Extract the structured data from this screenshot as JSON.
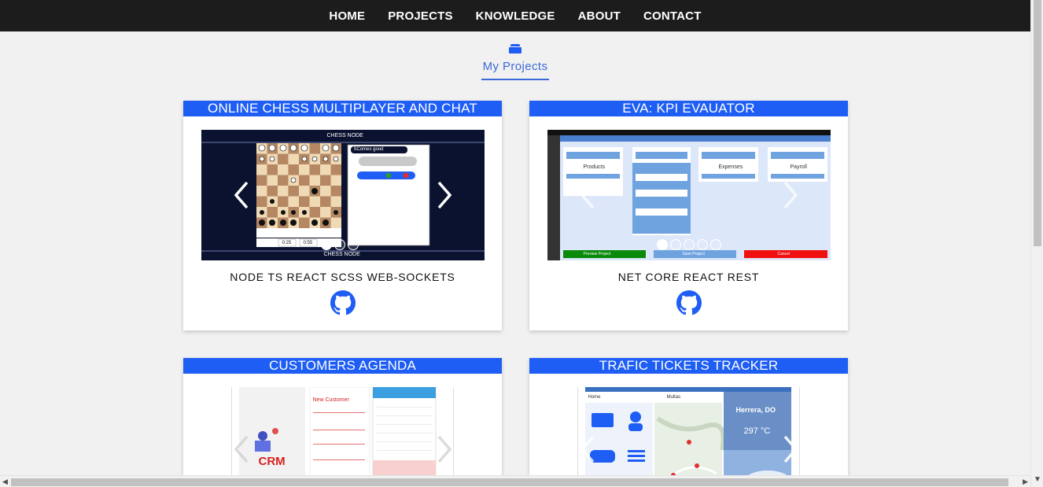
{
  "nav": {
    "items": [
      "HOME",
      "PROJECTS",
      "KNOWLEDGE",
      "ABOUT",
      "CONTACT"
    ]
  },
  "section": {
    "icon": "briefcase-icon",
    "title": "My Projects"
  },
  "projects": [
    {
      "title": "ONLINE CHESS MULTIPLAYER AND CHAT",
      "tech": "NODE TS REACT SCSS WEB-SOCKETS",
      "link_icon": "github-icon",
      "dots": 3,
      "active_dot": 1,
      "screenshot": {
        "header": "CHESS NODE",
        "footer": "CHESS NODE",
        "chat_message": "SComes good",
        "timer_left": "0:25",
        "timer_right": "0:55"
      }
    },
    {
      "title": "EVA: KPI EVAUATOR",
      "tech": "NET CORE REACT REST",
      "link_icon": "github-icon",
      "dots": 5,
      "active_dot": 0,
      "screenshot": {
        "panels": [
          "Products",
          "Expenses",
          "Payroll"
        ],
        "buttons": [
          "Preview Project",
          "Save Project",
          "Cancel"
        ]
      }
    },
    {
      "title": "CUSTOMERS AGENDA",
      "tech": "",
      "screenshot": {
        "logo": "CRM",
        "form_title": "New Customer"
      }
    },
    {
      "title": "TRAFIC TICKETS TRACKER",
      "tech": "",
      "screenshot": {
        "screen1": "Home",
        "screen2": "Multas",
        "screen3_title": "Herrera, DO",
        "temperature": "297 °C"
      }
    }
  ],
  "colors": {
    "navbar": "#1c1c1c",
    "accent": "#1e5ef5",
    "section_title": "#3b6ad8",
    "page_bg": "#f1f1f1"
  }
}
